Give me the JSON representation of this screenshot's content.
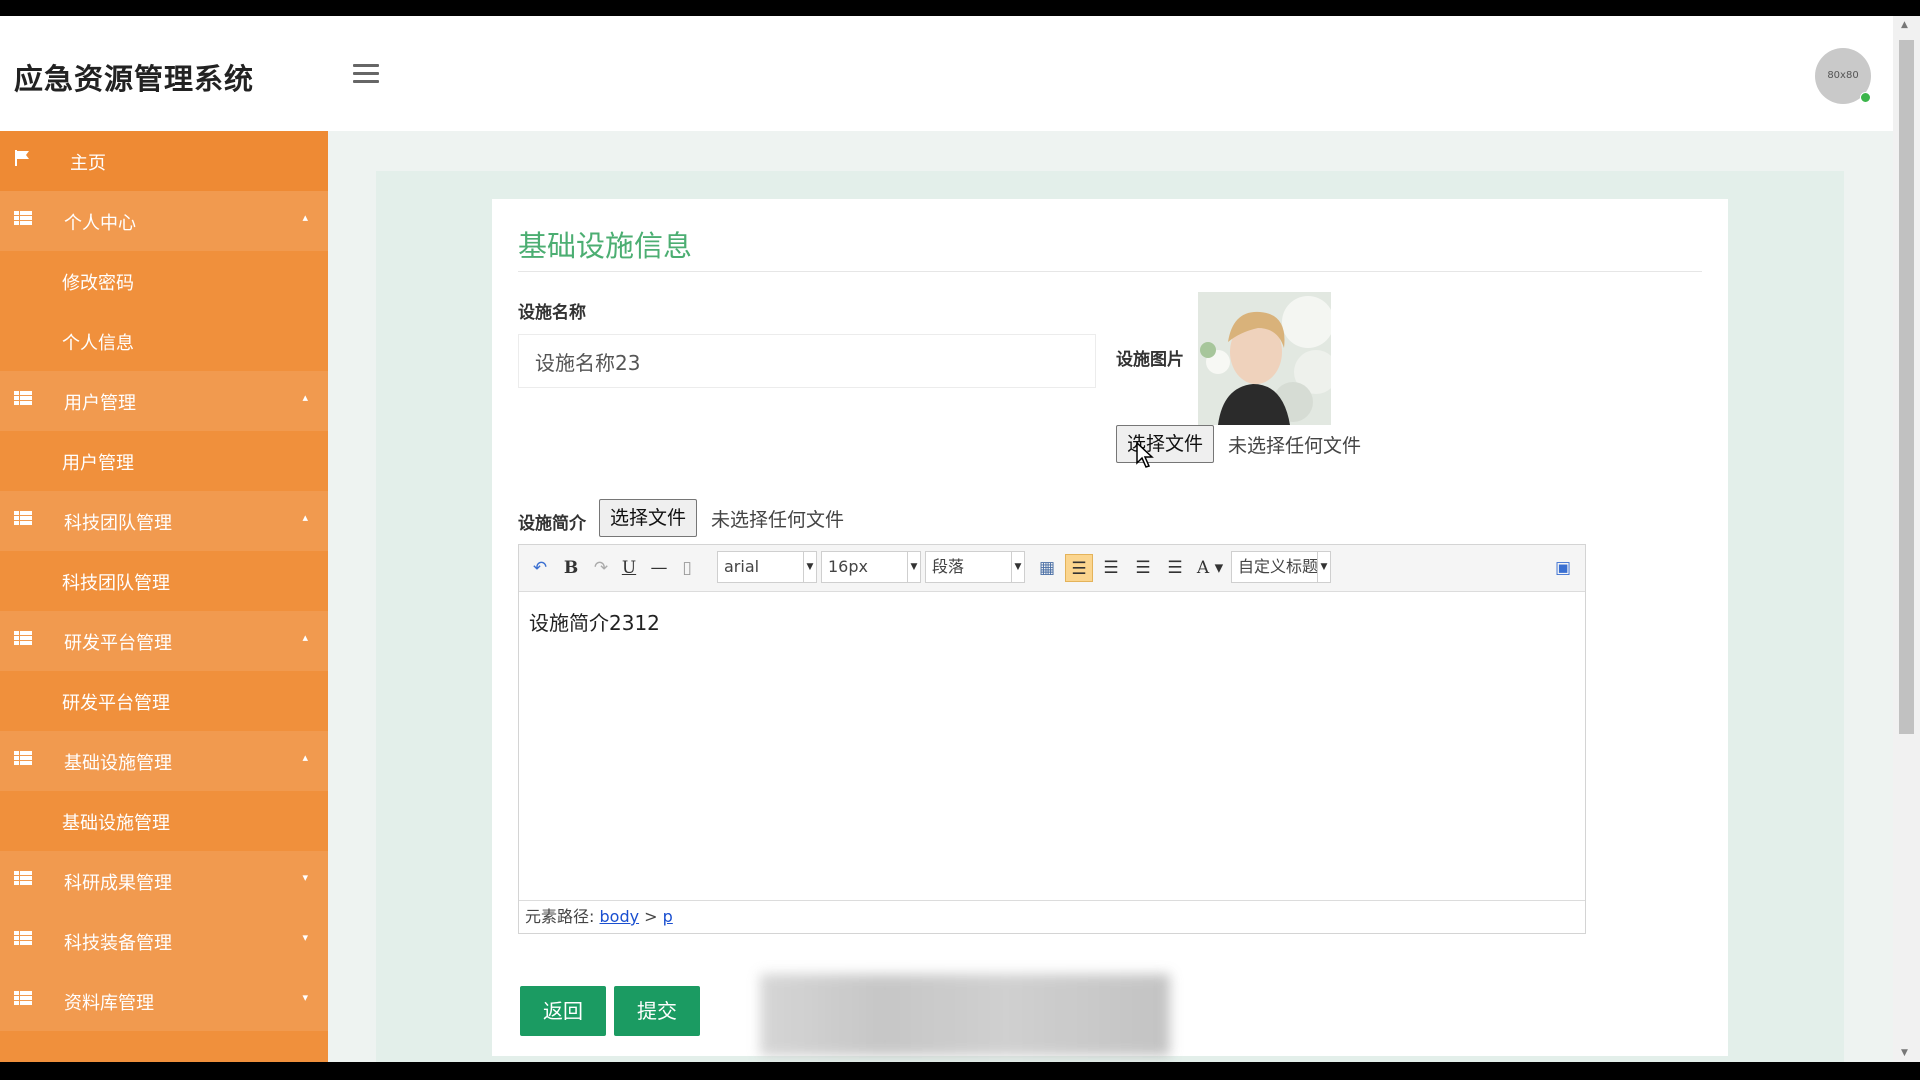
{
  "app": {
    "title": "应急资源管理系统",
    "avatar_text": "80x80"
  },
  "sidebar": {
    "items": [
      {
        "label": "主页",
        "kind": "home",
        "icon": "flag-icon"
      },
      {
        "label": "个人中心",
        "kind": "group",
        "caret": "up"
      },
      {
        "label": "修改密码",
        "kind": "sub"
      },
      {
        "label": "个人信息",
        "kind": "sub"
      },
      {
        "label": "用户管理",
        "kind": "group",
        "caret": "up"
      },
      {
        "label": "用户管理",
        "kind": "sub"
      },
      {
        "label": "科技团队管理",
        "kind": "group",
        "caret": "up"
      },
      {
        "label": "科技团队管理",
        "kind": "sub"
      },
      {
        "label": "研发平台管理",
        "kind": "group",
        "caret": "up"
      },
      {
        "label": "研发平台管理",
        "kind": "sub"
      },
      {
        "label": "基础设施管理",
        "kind": "group",
        "caret": "up"
      },
      {
        "label": "基础设施管理",
        "kind": "sub"
      },
      {
        "label": "科研成果管理",
        "kind": "group",
        "caret": "down"
      },
      {
        "label": "科技装备管理",
        "kind": "group",
        "caret": "down"
      },
      {
        "label": "资料库管理",
        "kind": "group",
        "caret": "down"
      }
    ]
  },
  "form": {
    "title": "基础设施信息",
    "name_label": "设施名称",
    "name_value": "设施名称23",
    "image_label": "设施图片",
    "image_file_button": "选择文件",
    "image_file_status": "未选择任何文件",
    "intro_label": "设施简介",
    "intro_file_button": "选择文件",
    "intro_file_status": "未选择任何文件",
    "editor": {
      "font_family": "arial",
      "font_size": "16px",
      "paragraph": "段落",
      "custom_heading": "自定义标题",
      "content": "设施简介2312",
      "path_label": "元素路径:",
      "path_body": "body",
      "path_sep": ">",
      "path_p": "p"
    },
    "back_button": "返回",
    "submit_button": "提交"
  },
  "colors": {
    "sidebar": "#f0903c",
    "accent_green": "#1b9b62",
    "title_green": "#4cae72"
  }
}
